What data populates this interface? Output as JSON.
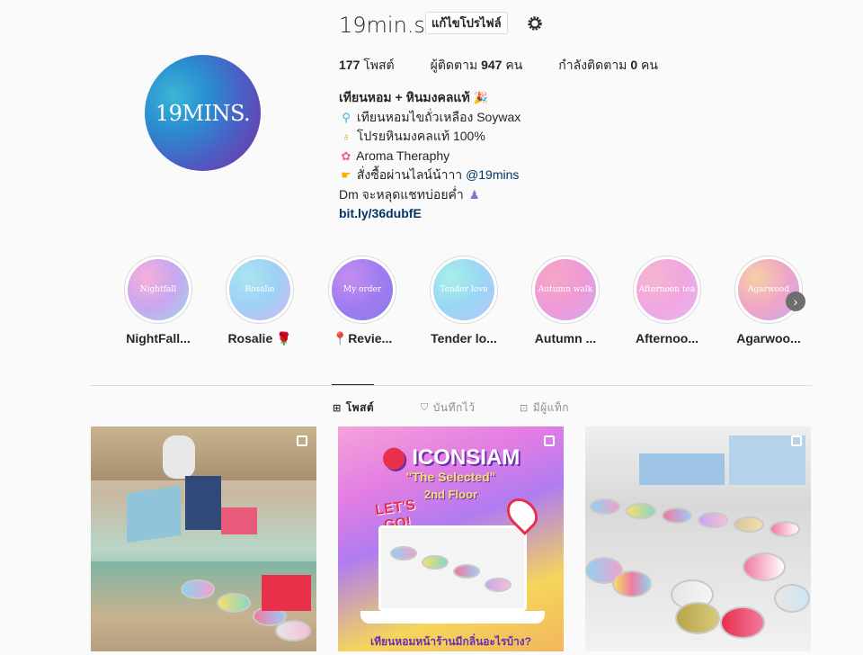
{
  "profile": {
    "avatar_text": "19MINS.",
    "username": "19min.s",
    "edit_button": "แก้ไขโปรไฟล์"
  },
  "stats": {
    "posts_count": "177",
    "posts_label": "โพสต์",
    "followers_label": "ผู้ติดตาม",
    "followers_count": "947",
    "followers_unit": "คน",
    "following_label": "กำลังติดตาม",
    "following_count": "0",
    "following_unit": "คน"
  },
  "bio": {
    "name": "เทียนหอม + หินมงคลแท้",
    "line1": "เทียนหอมไขถั่วเหลือง Soywax",
    "line2": "โปรยหินมงคลแท้ 100%",
    "line3": "Aroma Theraphy",
    "line4_prefix": "สั่งซื้อผ่านไลน์น้าาา",
    "line4_mention": "@19mins",
    "line5": "Dm จะหลุดแชทบ่อยค่ำ",
    "link": "bit.ly/36dubfE"
  },
  "highlights": [
    {
      "label": "NightFall...",
      "cover": "Nightfall"
    },
    {
      "label": "Rosalie 🌹",
      "cover": "Rosalie"
    },
    {
      "label": "📍Revie...",
      "cover": "My order"
    },
    {
      "label": "Tender lo...",
      "cover": "Tender love"
    },
    {
      "label": "Autumn ...",
      "cover": "Autumn walk"
    },
    {
      "label": "Afternoo...",
      "cover": "Afternoon tea"
    },
    {
      "label": "Agarwoo...",
      "cover": "Agarwood"
    }
  ],
  "tabs": [
    {
      "label": "โพสต์",
      "icon": "grid-icon"
    },
    {
      "label": "บันทึกไว้",
      "icon": "bookmark-icon"
    },
    {
      "label": "มีผู้แท็ก",
      "icon": "tag-icon"
    }
  ],
  "posts": [
    {
      "alt": "store"
    },
    {
      "title": "ICONSIAM",
      "subtitle": "\"The Selected\"",
      "floor": "2nd Floor",
      "cta": "LET'S GO!",
      "bottom": "เทียนหอมหน้าร้านมีกลิ่นอะไรบ้าง?"
    },
    {
      "alt": "tins"
    }
  ],
  "colors": {
    "accent_link": "#00376b",
    "text": "#262626",
    "muted": "#8e8e8e",
    "border": "#dbdbdb"
  }
}
